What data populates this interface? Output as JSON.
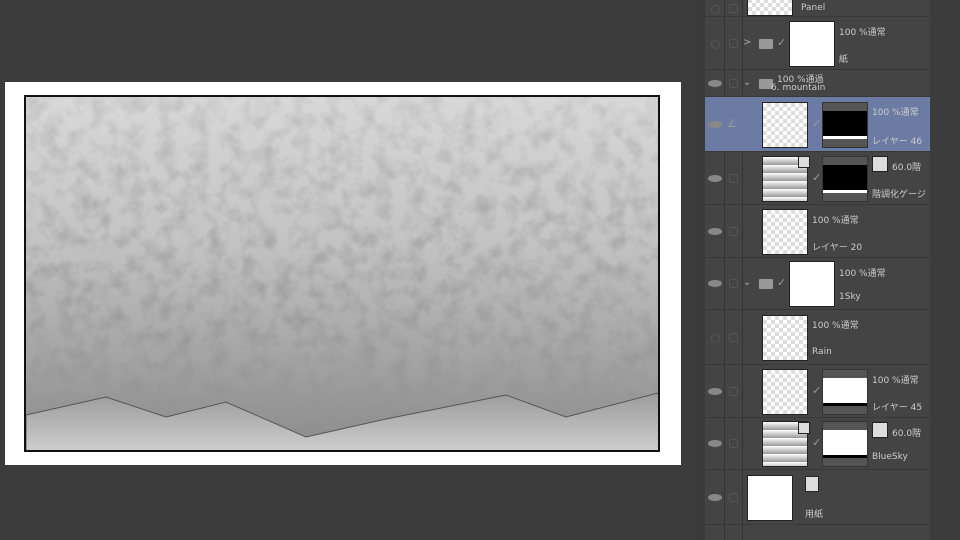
{
  "layers": [
    {
      "name": "Panel",
      "mode": "",
      "thumb": "check",
      "h": 17,
      "eye": false
    },
    {
      "name": "紙",
      "mode": "100 %通常",
      "thumb": "plain",
      "folder": true,
      "arrow": ">",
      "h": 53,
      "eye": false,
      "thumbx": true
    },
    {
      "name": "6. mountain",
      "mode": "100 %通過",
      "folder": true,
      "arrow": "⌄",
      "h": 27,
      "eye": true,
      "nothumb": true
    },
    {
      "name": "レイヤー 46",
      "mode": "100 %通常",
      "thumb": "check",
      "mask": "black",
      "h": 55,
      "eye": true,
      "selected": true,
      "pen": true,
      "indent": true
    },
    {
      "name": "階調化ゲージ",
      "mode": "60.0階",
      "thumb": "grad",
      "mask": "black",
      "h": 53,
      "eye": true,
      "indent": true,
      "tag": true,
      "small": true
    },
    {
      "name": "レイヤー 20",
      "mode": "100 %通常",
      "thumb": "check",
      "h": 53,
      "eye": true,
      "indent": true
    },
    {
      "name": "1Sky",
      "mode": "100 %通常",
      "thumb": "plain",
      "folder": true,
      "arrow": "⌄",
      "h": 52,
      "eye": true,
      "thumbx": true
    },
    {
      "name": "Rain",
      "mode": "100 %通常",
      "thumb": "check",
      "h": 55,
      "eye": false,
      "indent": true
    },
    {
      "name": "レイヤー 45",
      "mode": "100 %通常",
      "thumb": "check",
      "mask": "white",
      "h": 53,
      "eye": true,
      "indent": true
    },
    {
      "name": "BlueSky",
      "mode": "60.0階",
      "thumb": "grad",
      "mask": "white",
      "h": 52,
      "eye": true,
      "indent": true,
      "tag": true,
      "small": true
    },
    {
      "name": "用紙",
      "mode": "",
      "thumb": "plain",
      "h": 55,
      "eye": true,
      "paper": true
    }
  ]
}
